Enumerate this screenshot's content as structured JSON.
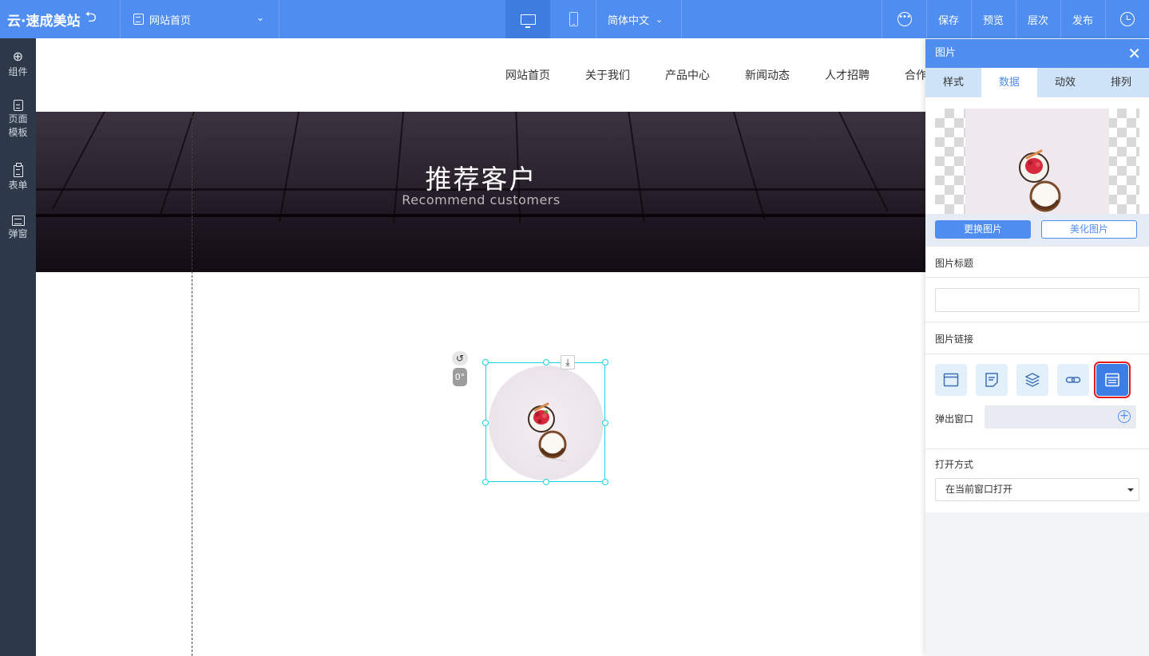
{
  "topbar": {
    "logo": "云·速成美站",
    "undo_icon": "undo-icon",
    "page_select": "网站首页",
    "language": "简体中文",
    "actions": {
      "save": "保存",
      "preview": "预览",
      "layers": "层次",
      "publish": "发布"
    }
  },
  "sidebar": {
    "items": [
      {
        "label": "组件",
        "icon": "plus-circle-icon"
      },
      {
        "label1": "页面",
        "label2": "模板",
        "icon": "document-icon"
      },
      {
        "label": "表单",
        "icon": "clipboard-icon"
      },
      {
        "label": "弹窗",
        "icon": "window-icon"
      }
    ]
  },
  "canvas": {
    "nav": [
      "网站首页",
      "关于我们",
      "产品中心",
      "新闻动态",
      "人才招聘",
      "合作"
    ],
    "banner": {
      "title": "推荐客户",
      "subtitle": "Recommend customers"
    },
    "rotation_label": "0°"
  },
  "panel": {
    "title": "图片",
    "tabs": [
      "样式",
      "数据",
      "动效",
      "排列"
    ],
    "active_tab": "数据",
    "replace_image": "更换图片",
    "beautify_image": "美化图片",
    "image_title_label": "图片标题",
    "image_title_value": "",
    "image_link_label": "图片链接",
    "popup_label": "弹出窗口",
    "open_mode_label": "打开方式",
    "open_mode_value": "在当前窗口打开"
  },
  "colors": {
    "topbar": "#4f8ef0",
    "sidebar": "#2d3848",
    "selection": "#19d6e3",
    "highlight": "#e11b1b"
  }
}
